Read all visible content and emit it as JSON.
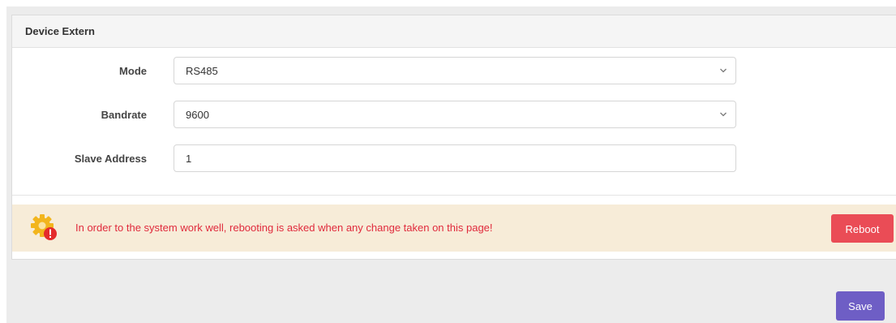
{
  "panel": {
    "title": "Device Extern"
  },
  "form": {
    "mode": {
      "label": "Mode",
      "value": "RS485",
      "icon": "chevron-down-icon"
    },
    "bandrate": {
      "label": "Bandrate",
      "value": "9600",
      "icon": "chevron-down-icon"
    },
    "slave_address": {
      "label": "Slave Address",
      "value": "1"
    }
  },
  "alert": {
    "icon": "gear-warning-icon",
    "message": "In order to the system work well, rebooting is asked when any change taken on this page!",
    "reboot_label": "Reboot"
  },
  "footer": {
    "save_label": "Save"
  },
  "colors": {
    "alert_background": "#f7ecd8",
    "alert_text": "#e02a3c",
    "reboot_button": "#ea4c56",
    "save_button": "#6e5ec5",
    "page_background": "#ececec"
  }
}
